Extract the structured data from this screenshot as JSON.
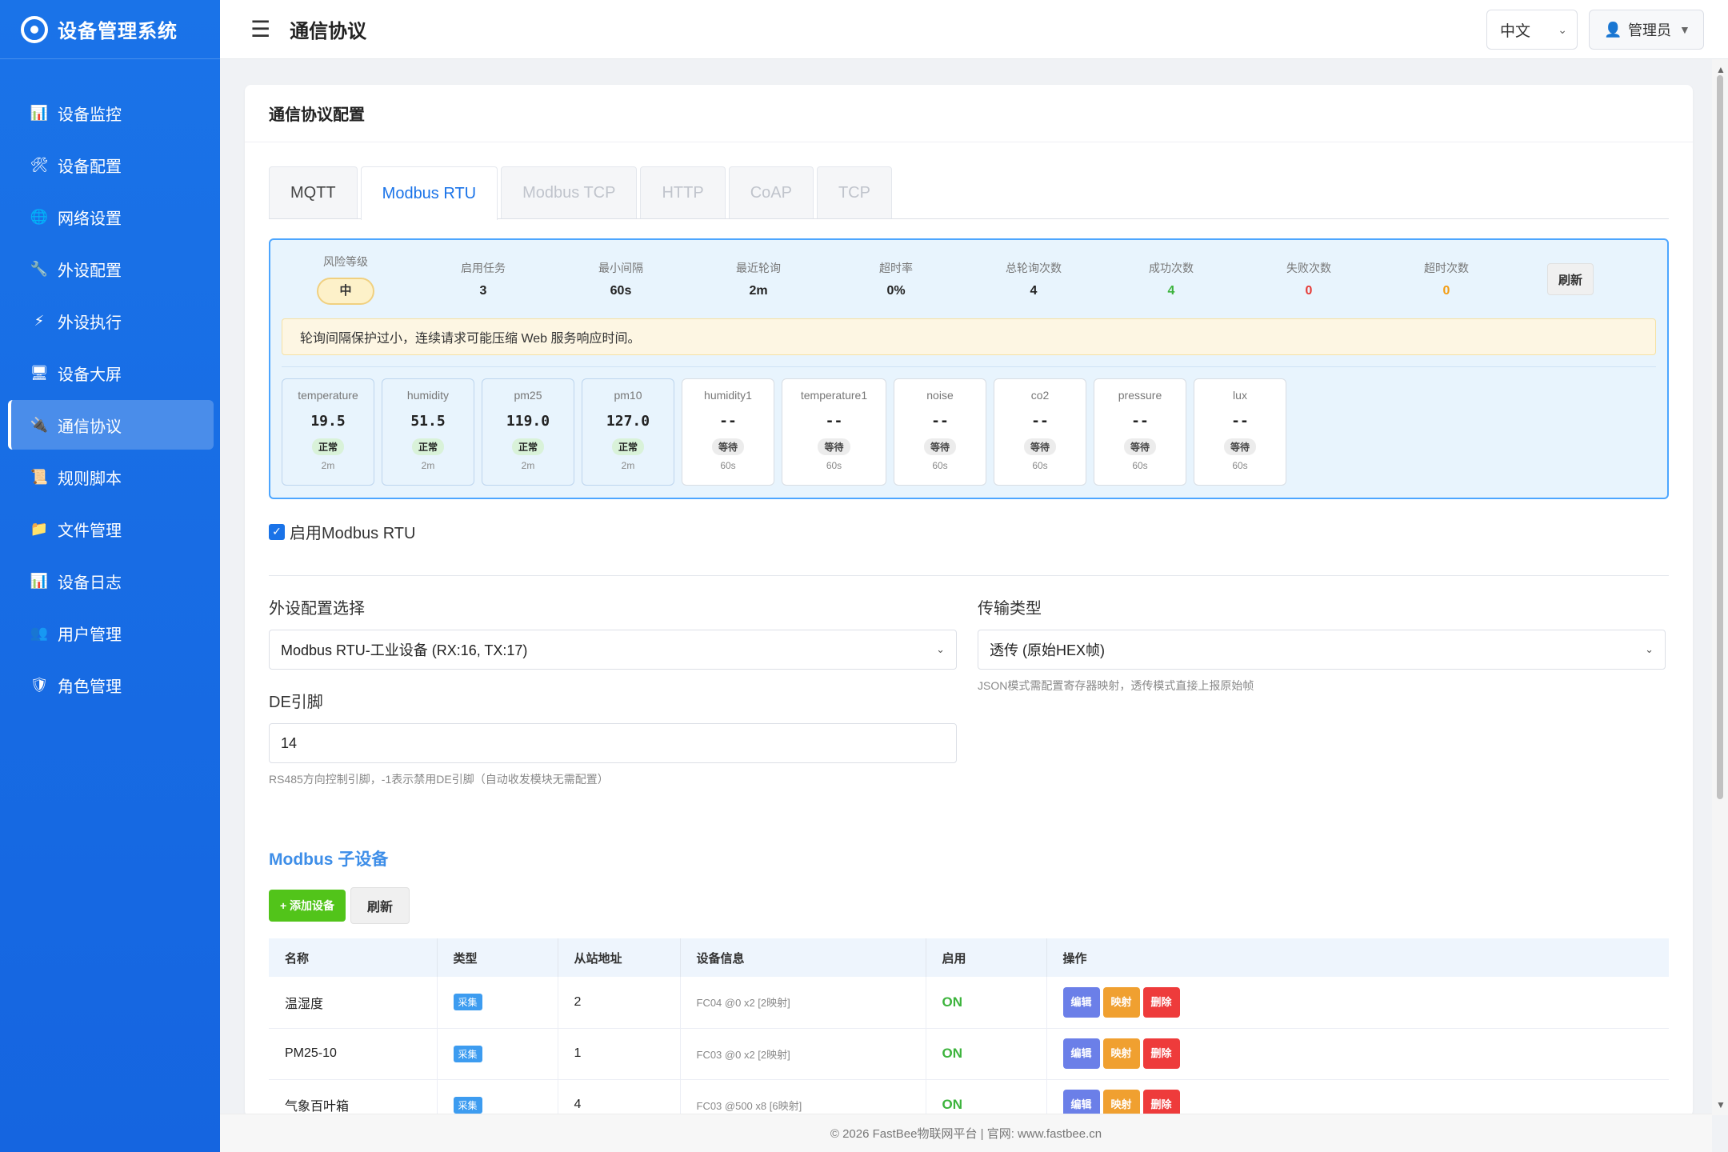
{
  "brand": {
    "title": "设备管理系统"
  },
  "sidebar": {
    "items": [
      {
        "label": "设备监控",
        "icon": "bar-chart-icon",
        "glyph": "📊"
      },
      {
        "label": "设备配置",
        "icon": "tools-icon",
        "glyph": "🛠"
      },
      {
        "label": "网络设置",
        "icon": "globe-icon",
        "glyph": "🌐"
      },
      {
        "label": "外设配置",
        "icon": "wrench-icon",
        "glyph": "🔧"
      },
      {
        "label": "外设执行",
        "icon": "lightning-icon",
        "glyph": "⚡"
      },
      {
        "label": "设备大屏",
        "icon": "monitor-icon",
        "glyph": "🖥"
      },
      {
        "label": "通信协议",
        "icon": "plug-icon",
        "glyph": "🔌",
        "active": true
      },
      {
        "label": "规则脚本",
        "icon": "script-icon",
        "glyph": "📜"
      },
      {
        "label": "文件管理",
        "icon": "folder-icon",
        "glyph": "📁"
      },
      {
        "label": "设备日志",
        "icon": "log-chart-icon",
        "glyph": "📊"
      },
      {
        "label": "用户管理",
        "icon": "users-icon",
        "glyph": "👥"
      },
      {
        "label": "角色管理",
        "icon": "shield-icon",
        "glyph": "🛡"
      }
    ]
  },
  "header": {
    "title": "通信协议",
    "language": "中文",
    "user": "管理员"
  },
  "card": {
    "title": "通信协议配置"
  },
  "tabs": [
    "MQTT",
    "Modbus RTU",
    "Modbus TCP",
    "HTTP",
    "CoAP",
    "TCP"
  ],
  "stats": {
    "risk_label": "风险等级",
    "risk_value": "中",
    "tasks_label": "启用任务",
    "tasks_value": "3",
    "min_interval_label": "最小间隔",
    "min_interval_value": "60s",
    "last_poll_label": "最近轮询",
    "last_poll_value": "2m",
    "timeout_rate_label": "超时率",
    "timeout_rate_value": "0%",
    "total_label": "总轮询次数",
    "total_value": "4",
    "success_label": "成功次数",
    "success_value": "4",
    "fail_label": "失败次数",
    "fail_value": "0",
    "timeout_count_label": "超时次数",
    "timeout_count_value": "0",
    "refresh_label": "刷新"
  },
  "warning": "轮询间隔保护过小，连续请求可能压缩 Web 服务响应时间。",
  "sensors": [
    {
      "name": "temperature",
      "value": "19.5",
      "status": "正常",
      "interval": "2m",
      "ok": true
    },
    {
      "name": "humidity",
      "value": "51.5",
      "status": "正常",
      "interval": "2m",
      "ok": true
    },
    {
      "name": "pm25",
      "value": "119.0",
      "status": "正常",
      "interval": "2m",
      "ok": true
    },
    {
      "name": "pm10",
      "value": "127.0",
      "status": "正常",
      "interval": "2m",
      "ok": true
    },
    {
      "name": "humidity1",
      "value": "--",
      "status": "等待",
      "interval": "60s",
      "ok": false
    },
    {
      "name": "temperature1",
      "value": "--",
      "status": "等待",
      "interval": "60s",
      "ok": false,
      "wide": true
    },
    {
      "name": "noise",
      "value": "--",
      "status": "等待",
      "interval": "60s",
      "ok": false
    },
    {
      "name": "co2",
      "value": "--",
      "status": "等待",
      "interval": "60s",
      "ok": false
    },
    {
      "name": "pressure",
      "value": "--",
      "status": "等待",
      "interval": "60s",
      "ok": false
    },
    {
      "name": "lux",
      "value": "--",
      "status": "等待",
      "interval": "60s",
      "ok": false
    }
  ],
  "enable_label": "启用Modbus RTU",
  "form": {
    "peripheral_label": "外设配置选择",
    "peripheral_value": "Modbus RTU-工业设备 (RX:16, TX:17)",
    "transfer_label": "传输类型",
    "transfer_value": "透传 (原始HEX帧)",
    "transfer_help": "JSON模式需配置寄存器映射，透传模式直接上报原始帧",
    "de_label": "DE引脚",
    "de_value": "14",
    "de_help": "RS485方向控制引脚，-1表示禁用DE引脚（自动收发模块无需配置）"
  },
  "subdevices": {
    "title": "Modbus 子设备",
    "add_label": "+ 添加设备",
    "refresh_label": "刷新",
    "columns": [
      "名称",
      "类型",
      "从站地址",
      "设备信息",
      "启用",
      "操作"
    ],
    "rows": [
      {
        "name": "温湿度",
        "type": "采集",
        "address": "2",
        "info": "FC04 @0 x2 [2映射]",
        "enabled": "ON"
      },
      {
        "name": "PM25-10",
        "type": "采集",
        "address": "1",
        "info": "FC03 @0 x2 [2映射]",
        "enabled": "ON"
      },
      {
        "name": "气象百叶箱",
        "type": "采集",
        "address": "4",
        "info": "FC03 @500 x8 [6映射]",
        "enabled": "ON"
      }
    ],
    "edit_label": "编辑",
    "map_label": "映射",
    "delete_label": "删除"
  },
  "footer": "© 2026 FastBee物联网平台 | 官网: www.fastbee.cn"
}
